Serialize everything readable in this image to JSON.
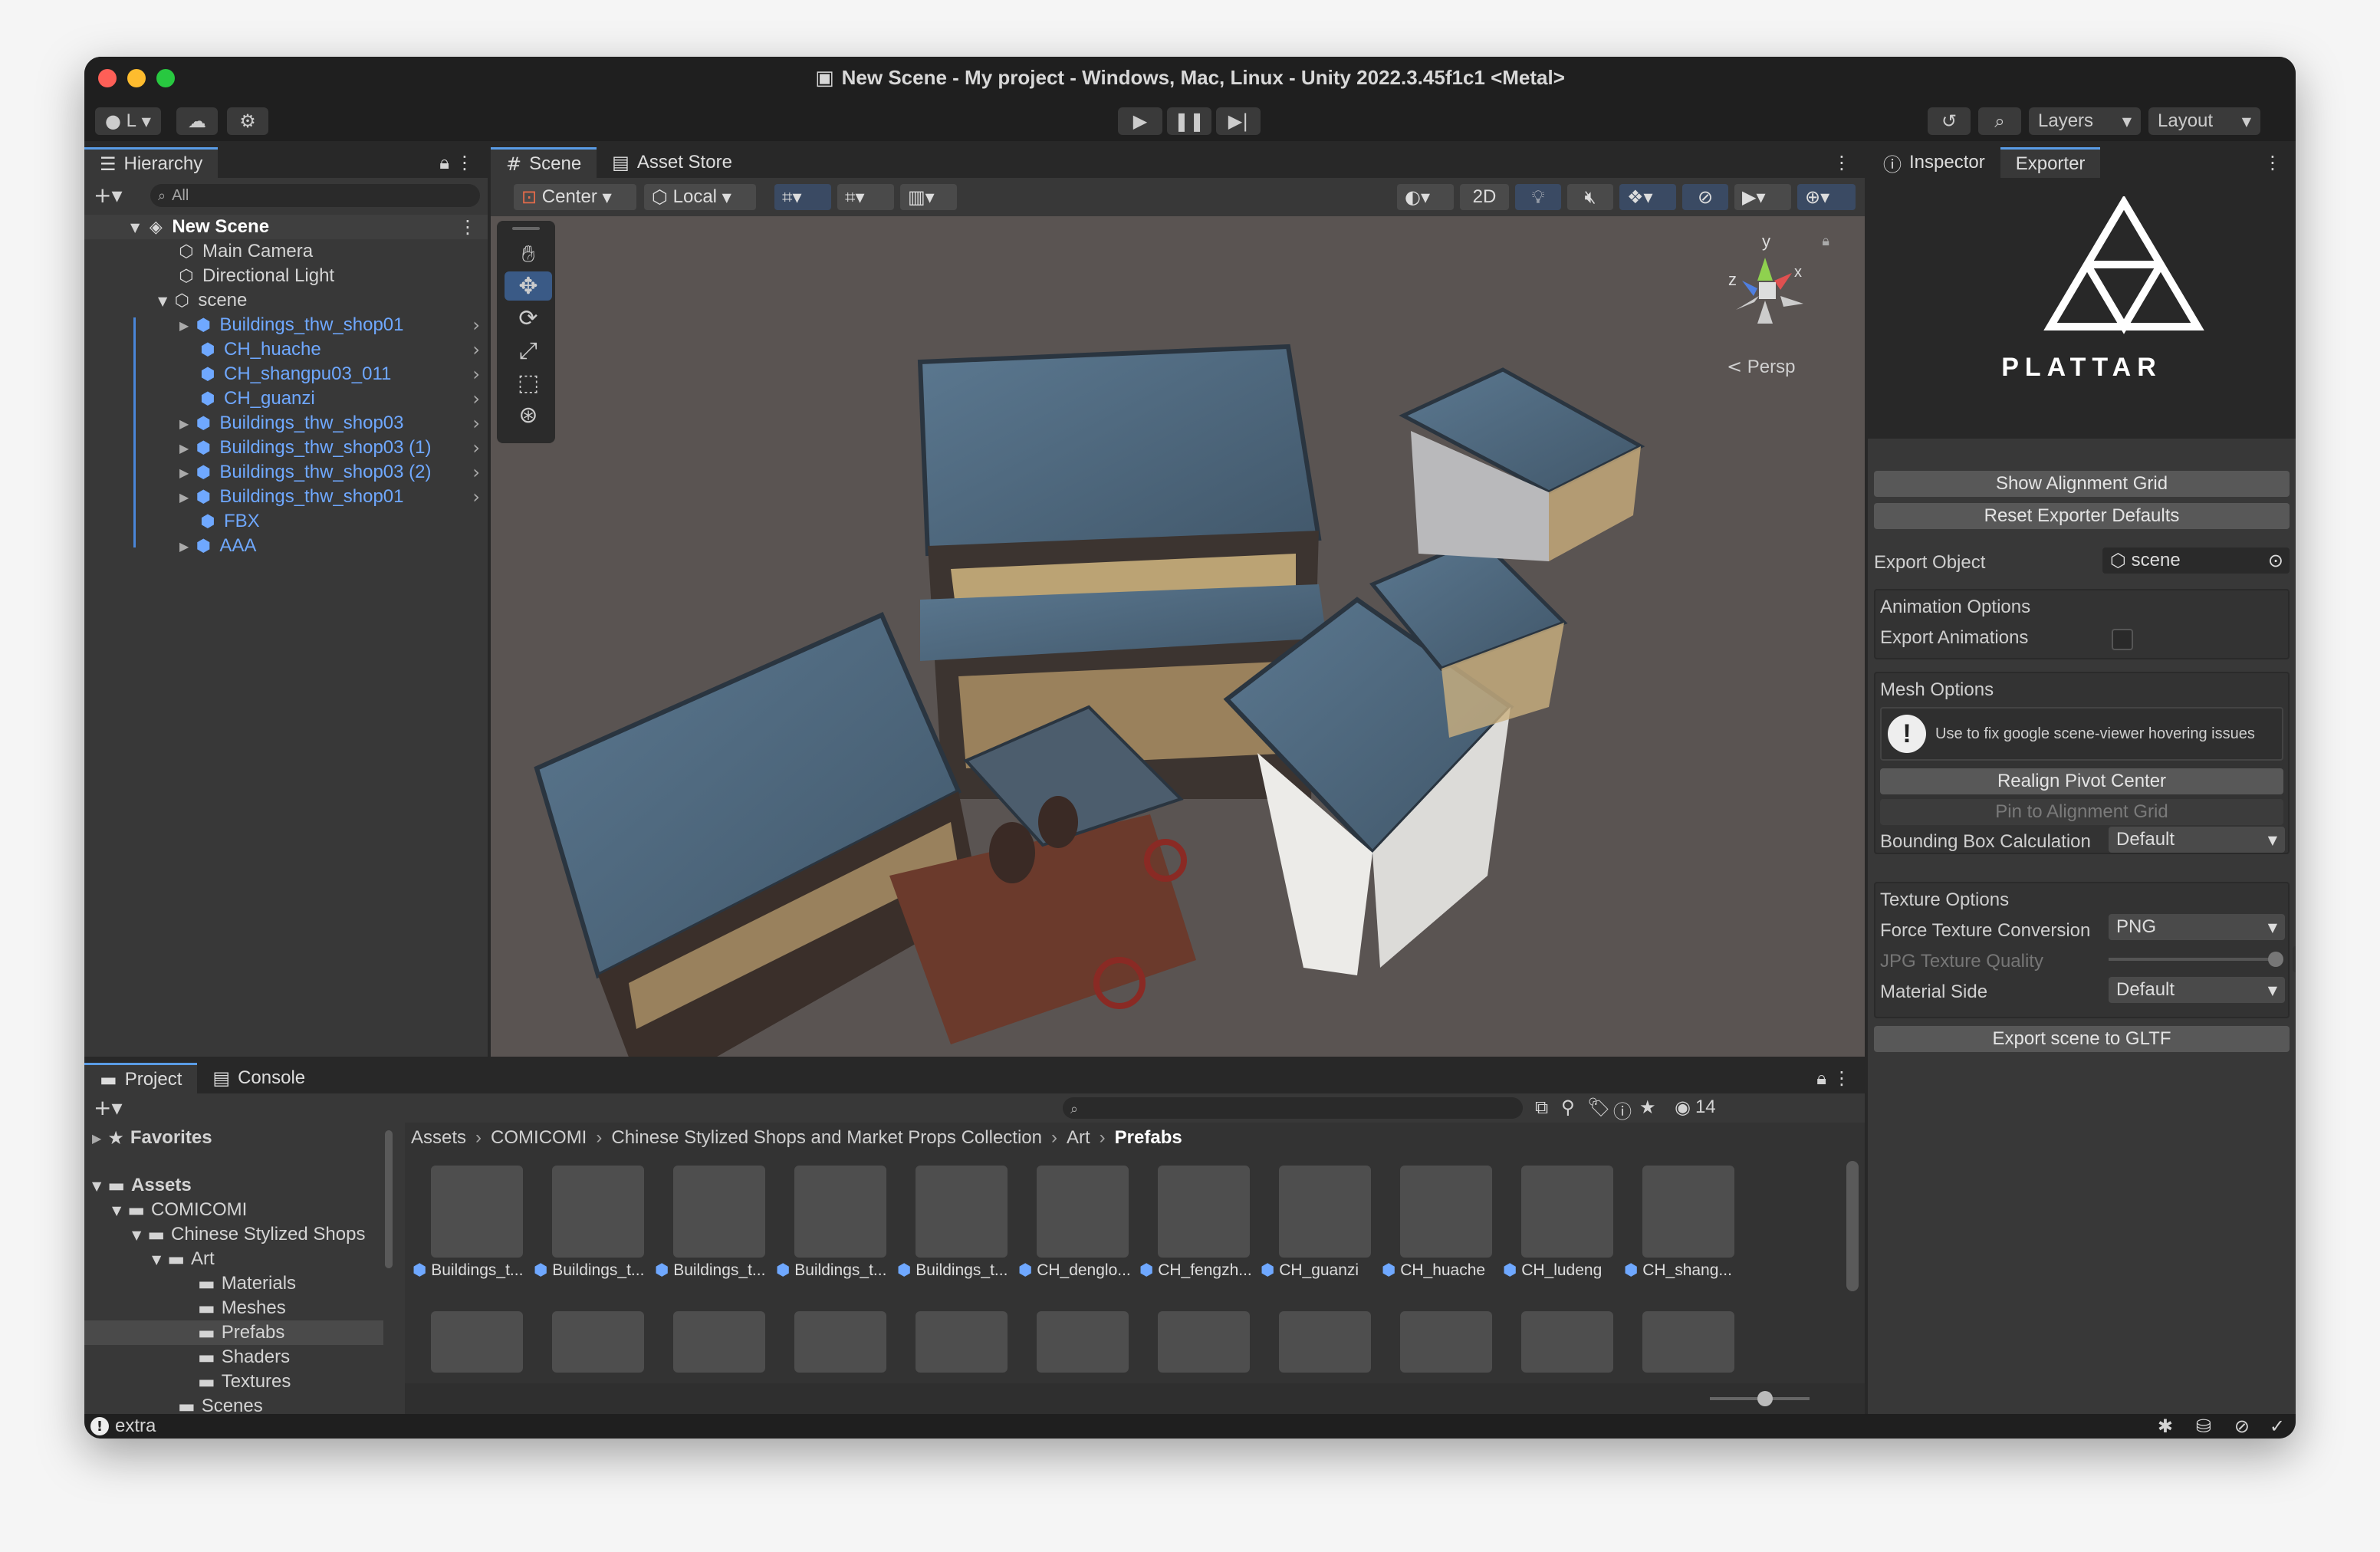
{
  "window": {
    "title": "New Scene - My project - Windows, Mac, Linux - Unity 2022.3.45f1c1 <Metal>"
  },
  "toolbar": {
    "account": "L",
    "layers": "Layers",
    "layout": "Layout"
  },
  "hierarchy": {
    "tab": "Hierarchy",
    "search_placeholder": "All",
    "scene": "New Scene",
    "items": [
      {
        "label": "Main Camera"
      },
      {
        "label": "Directional Light"
      },
      {
        "label": "scene"
      },
      {
        "label": "Buildings_thw_shop01"
      },
      {
        "label": "CH_huache"
      },
      {
        "label": "CH_shangpu03_011"
      },
      {
        "label": "CH_guanzi"
      },
      {
        "label": "Buildings_thw_shop03"
      },
      {
        "label": "Buildings_thw_shop03 (1)"
      },
      {
        "label": "Buildings_thw_shop03 (2)"
      },
      {
        "label": "Buildings_thw_shop01"
      },
      {
        "label": "FBX"
      },
      {
        "label": "AAA"
      }
    ]
  },
  "scene_view": {
    "tabs": [
      "Scene",
      "Asset Store"
    ],
    "pivot": "Center",
    "space": "Local",
    "mode_2d": "2D",
    "persp": "Persp",
    "axes": {
      "y": "y",
      "x": "x",
      "z": "z"
    }
  },
  "inspector": {
    "tabs": [
      "Inspector",
      "Exporter"
    ],
    "logo_text": "PLATTAR",
    "show_grid": "Show Alignment Grid",
    "reset_defaults": "Reset Exporter Defaults",
    "export_object_label": "Export Object",
    "export_object_value": "scene",
    "animation_title": "Animation Options",
    "export_animations": "Export Animations",
    "mesh_title": "Mesh Options",
    "mesh_note": "Use to fix google scene-viewer hovering issues",
    "realign": "Realign Pivot Center",
    "pin_grid": "Pin to Alignment Grid",
    "bbox_label": "Bounding Box Calculation",
    "bbox_value": "Default",
    "texture_title": "Texture Options",
    "force_tex_label": "Force Texture Conversion",
    "force_tex_value": "PNG",
    "jpg_label": "JPG Texture Quality",
    "jpg_value": "100",
    "material_label": "Material Side",
    "material_value": "Default",
    "export_btn": "Export scene to GLTF"
  },
  "project": {
    "tabs": [
      "Project",
      "Console"
    ],
    "count": "14",
    "favorites": "Favorites",
    "tree": [
      "Assets",
      "COMICOMI",
      "Chinese Stylized Shops",
      "Art",
      "Materials",
      "Meshes",
      "Prefabs",
      "Shaders",
      "Textures",
      "Scenes"
    ],
    "breadcrumb": [
      "Assets",
      "COMICOMI",
      "Chinese Stylized Shops and Market Props Collection",
      "Art",
      "Prefabs"
    ],
    "assets": [
      "Buildings_t...",
      "Buildings_t...",
      "Buildings_t...",
      "Buildings_t...",
      "Buildings_t...",
      "CH_denglo...",
      "CH_fengzh...",
      "CH_guanzi",
      "CH_huache",
      "CH_ludeng",
      "CH_shang..."
    ]
  },
  "status": {
    "text": "extra"
  }
}
